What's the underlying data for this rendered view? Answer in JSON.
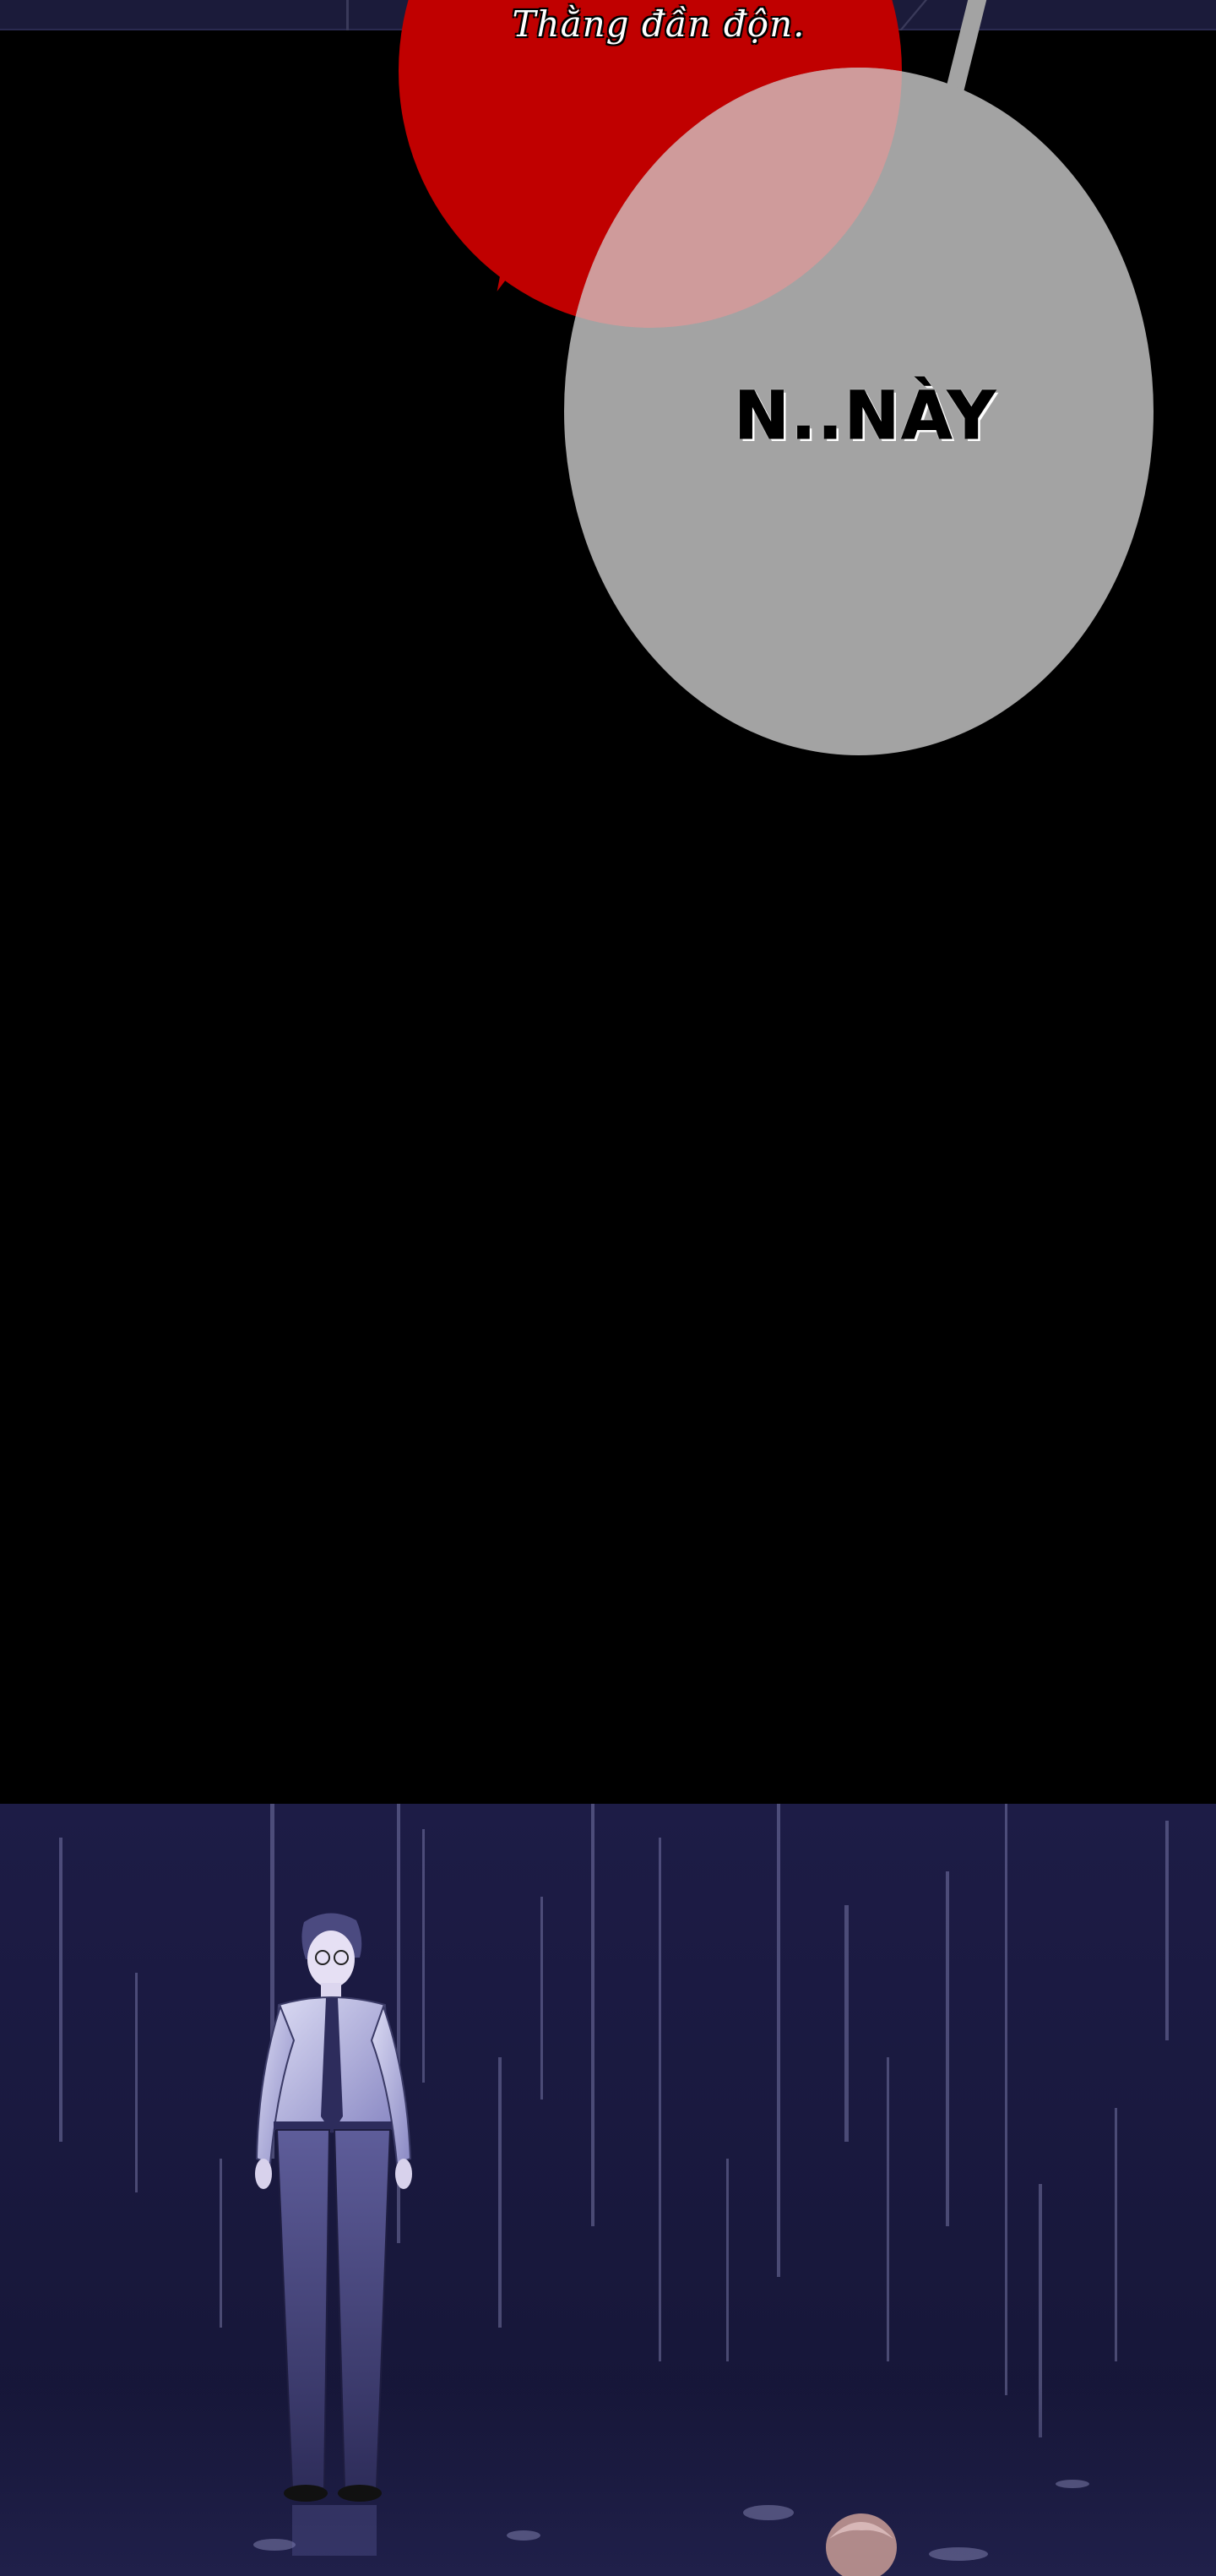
{
  "bubbles": {
    "red_line": "Thằng đần độn.",
    "grey_line": "N..NÀY"
  },
  "figures": {
    "standing_man": "man-in-rain",
    "head_peek": "head-in-water"
  },
  "colors": {
    "red_bubble": "#c00000",
    "grey_bubble": "#a3a3a3",
    "night_sky": "#1d1c46"
  }
}
